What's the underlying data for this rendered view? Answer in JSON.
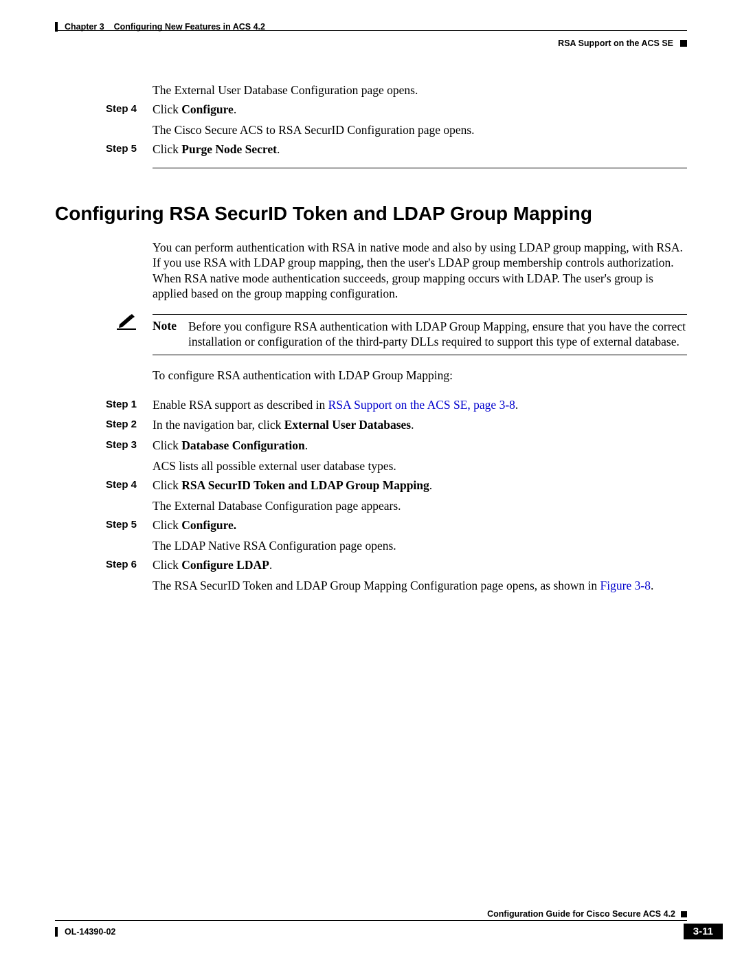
{
  "header": {
    "chapter_label": "Chapter 3",
    "chapter_title": "Configuring New Features in ACS 4.2",
    "section_right": "RSA Support on the ACS SE"
  },
  "top_steps": {
    "pre_text": "The External User Database Configuration page opens.",
    "s4_label": "Step 4",
    "s4_body_prefix": "Click ",
    "s4_body_bold": "Configure",
    "s4_body_suffix": ".",
    "s4_result": "The Cisco Secure ACS to RSA SecurID Configuration page opens.",
    "s5_label": "Step 5",
    "s5_body_prefix": "Click ",
    "s5_body_bold": "Purge Node Secret",
    "s5_body_suffix": "."
  },
  "section": {
    "heading": "Configuring RSA SecurID Token and LDAP Group Mapping",
    "intro": "You can perform authentication with RSA in native mode and also by using LDAP group mapping, with RSA. If you use RSA with LDAP group mapping, then the user's LDAP group membership controls authorization. When RSA native mode authentication succeeds, group mapping occurs with LDAP. The user's group is applied based on the group mapping configuration.",
    "note_label": "Note",
    "note_body": "Before you configure RSA authentication with LDAP Group Mapping, ensure that you have the correct installation or configuration of the third-party DLLs required to support this type of external database.",
    "config_intro": "To configure RSA authentication with LDAP Group Mapping:",
    "s1_label": "Step 1",
    "s1_prefix": "Enable RSA support as described in ",
    "s1_link": "RSA Support on the ACS SE, page 3-8",
    "s1_suffix": ".",
    "s2_label": "Step 2",
    "s2_prefix": "In the navigation bar, click ",
    "s2_bold": "External User Databases",
    "s2_suffix": ".",
    "s3_label": "Step 3",
    "s3_prefix": "Click ",
    "s3_bold": "Database Configuration",
    "s3_suffix": ".",
    "s3_result": "ACS lists all possible external user database types.",
    "s4_label": "Step 4",
    "s4_prefix": "Click ",
    "s4_bold": "RSA SecurID Token and LDAP Group Mapping",
    "s4_suffix": ".",
    "s4_result": "The External Database Configuration page appears.",
    "s5_label": "Step 5",
    "s5_prefix": "Click ",
    "s5_bold": "Configure.",
    "s5_result": "The LDAP Native RSA Configuration page opens.",
    "s6_label": "Step 6",
    "s6_prefix": "Click ",
    "s6_bold": "Configure LDAP",
    "s6_suffix": ".",
    "s6_result_prefix": "The RSA SecurID Token and LDAP Group Mapping Configuration page opens, as shown in ",
    "s6_result_link": "Figure 3-8",
    "s6_result_suffix": "."
  },
  "footer": {
    "guide_title": "Configuration Guide for Cisco Secure ACS 4.2",
    "doc_id": "OL-14390-02",
    "page_num": "3-11"
  }
}
